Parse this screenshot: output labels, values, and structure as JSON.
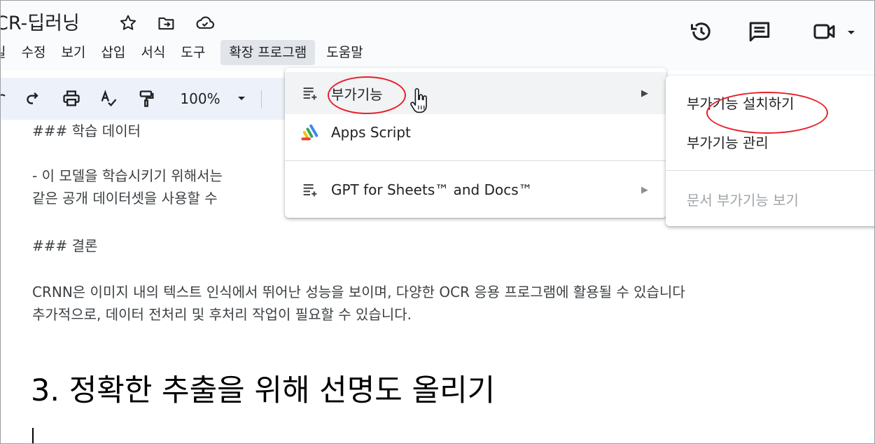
{
  "header": {
    "doc_title": "CR-딥러닝",
    "icons": [
      "star-icon",
      "move-to-folder-icon",
      "cloud-saved-icon",
      "version-history-icon",
      "comments-icon",
      "meet-video-icon",
      "dropdown-arrow-icon"
    ]
  },
  "menubar": {
    "items": [
      "일",
      "수정",
      "보기",
      "삽입",
      "서식",
      "도구",
      "확장 프로그램",
      "도움말"
    ],
    "active_index": 6
  },
  "toolbar": {
    "zoom": "100%",
    "icons": [
      "redo-icon",
      "print-icon",
      "spellcheck-icon",
      "paint-format-icon",
      "zoom-dropdown-icon"
    ]
  },
  "document": {
    "lines": [
      "### 학습 데이터",
      "- 이 모델을 학습시키기 위해서는",
      "같은 공개 데이터셋을 사용할 수 ",
      "### 결론",
      "CRNN은 이미지 내의 텍스트 인식에서 뛰어난 성능을 보이며, 다양한 OCR 응용 프로그램에 활용될 수 있습니다",
      "추가적으로, 데이터 전처리 및 후처리 작업이 필요할 수 있습니다."
    ],
    "heading": "3. 정확한 추출을 위해 선명도 올리기"
  },
  "extensions_menu": {
    "items": [
      {
        "label": "부가기능",
        "icon": "addons-icon",
        "has_submenu": true
      },
      {
        "label": "Apps Script",
        "icon": "apps-script-icon",
        "has_submenu": false
      },
      {
        "label": "GPT for Sheets™ and Docs™",
        "icon": "addons-icon",
        "has_submenu": true
      }
    ]
  },
  "addons_submenu": {
    "items": [
      {
        "label": "부가기능 설치하기",
        "disabled": false
      },
      {
        "label": "부가기능 관리",
        "disabled": false
      },
      {
        "label": "문서 부가기능 보기",
        "disabled": true
      }
    ]
  },
  "colors": {
    "annotation": "#e8202a",
    "toolbar_bg": "#edf2fa",
    "header_bg": "#f9fbfd"
  }
}
